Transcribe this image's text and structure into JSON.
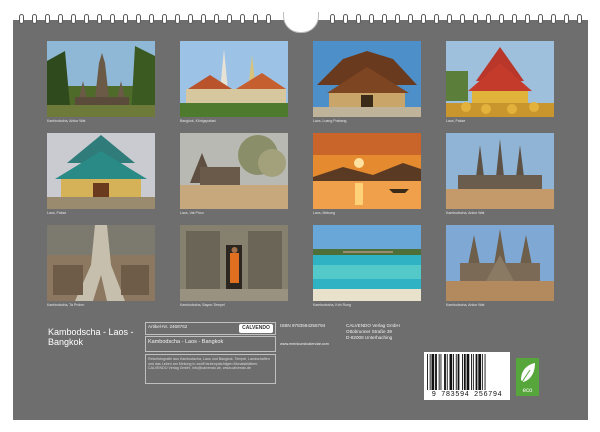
{
  "cover": {
    "title": "Kambodscha - Laos - Bangkok"
  },
  "photos": [
    {
      "caption": "Kambodscha, Ankor Wat"
    },
    {
      "caption": "Bangkok, Königspalast"
    },
    {
      "caption": "Laos, Luang Prabang"
    },
    {
      "caption": "Laos, Pakse"
    },
    {
      "caption": "Laos, Pakse"
    },
    {
      "caption": "Laos, Vat Phou"
    },
    {
      "caption": "Laos, Mekong"
    },
    {
      "caption": "Kambodscha, Ankor Wat"
    },
    {
      "caption": "Kambodscha, Ta Prohm"
    },
    {
      "caption": "Kambodscha, Bayon-Tempel"
    },
    {
      "caption": "Kambodscha, Koh Rong"
    },
    {
      "caption": "Kambodscha, Ankor Wat"
    }
  ],
  "product": {
    "article_label": "Artikel-Nr. 2468762",
    "publisher_logo": "CALVENDO",
    "isbn": "ISBN 9783594256794",
    "website": "www.meinkunstcalendar.com",
    "title": "Kambodscha - Laos - Bangkok",
    "publisher_lines": [
      "CALVENDO Verlag GmbH",
      "Ottobrunner Straße 39",
      "D-82008 Unterhaching"
    ],
    "fine_print": "Reisefotografie aus Kambodscha, Laos und Bangkok. Tempel, Landschaften und das Leben am Mekong in zwölf farbenprächtigen Monatsblättern. CALVENDO Verlag GmbH, info@calvendo.de, www.calvendo.de",
    "barcode_number": "9 783594 256794",
    "eco_label": "eco"
  }
}
